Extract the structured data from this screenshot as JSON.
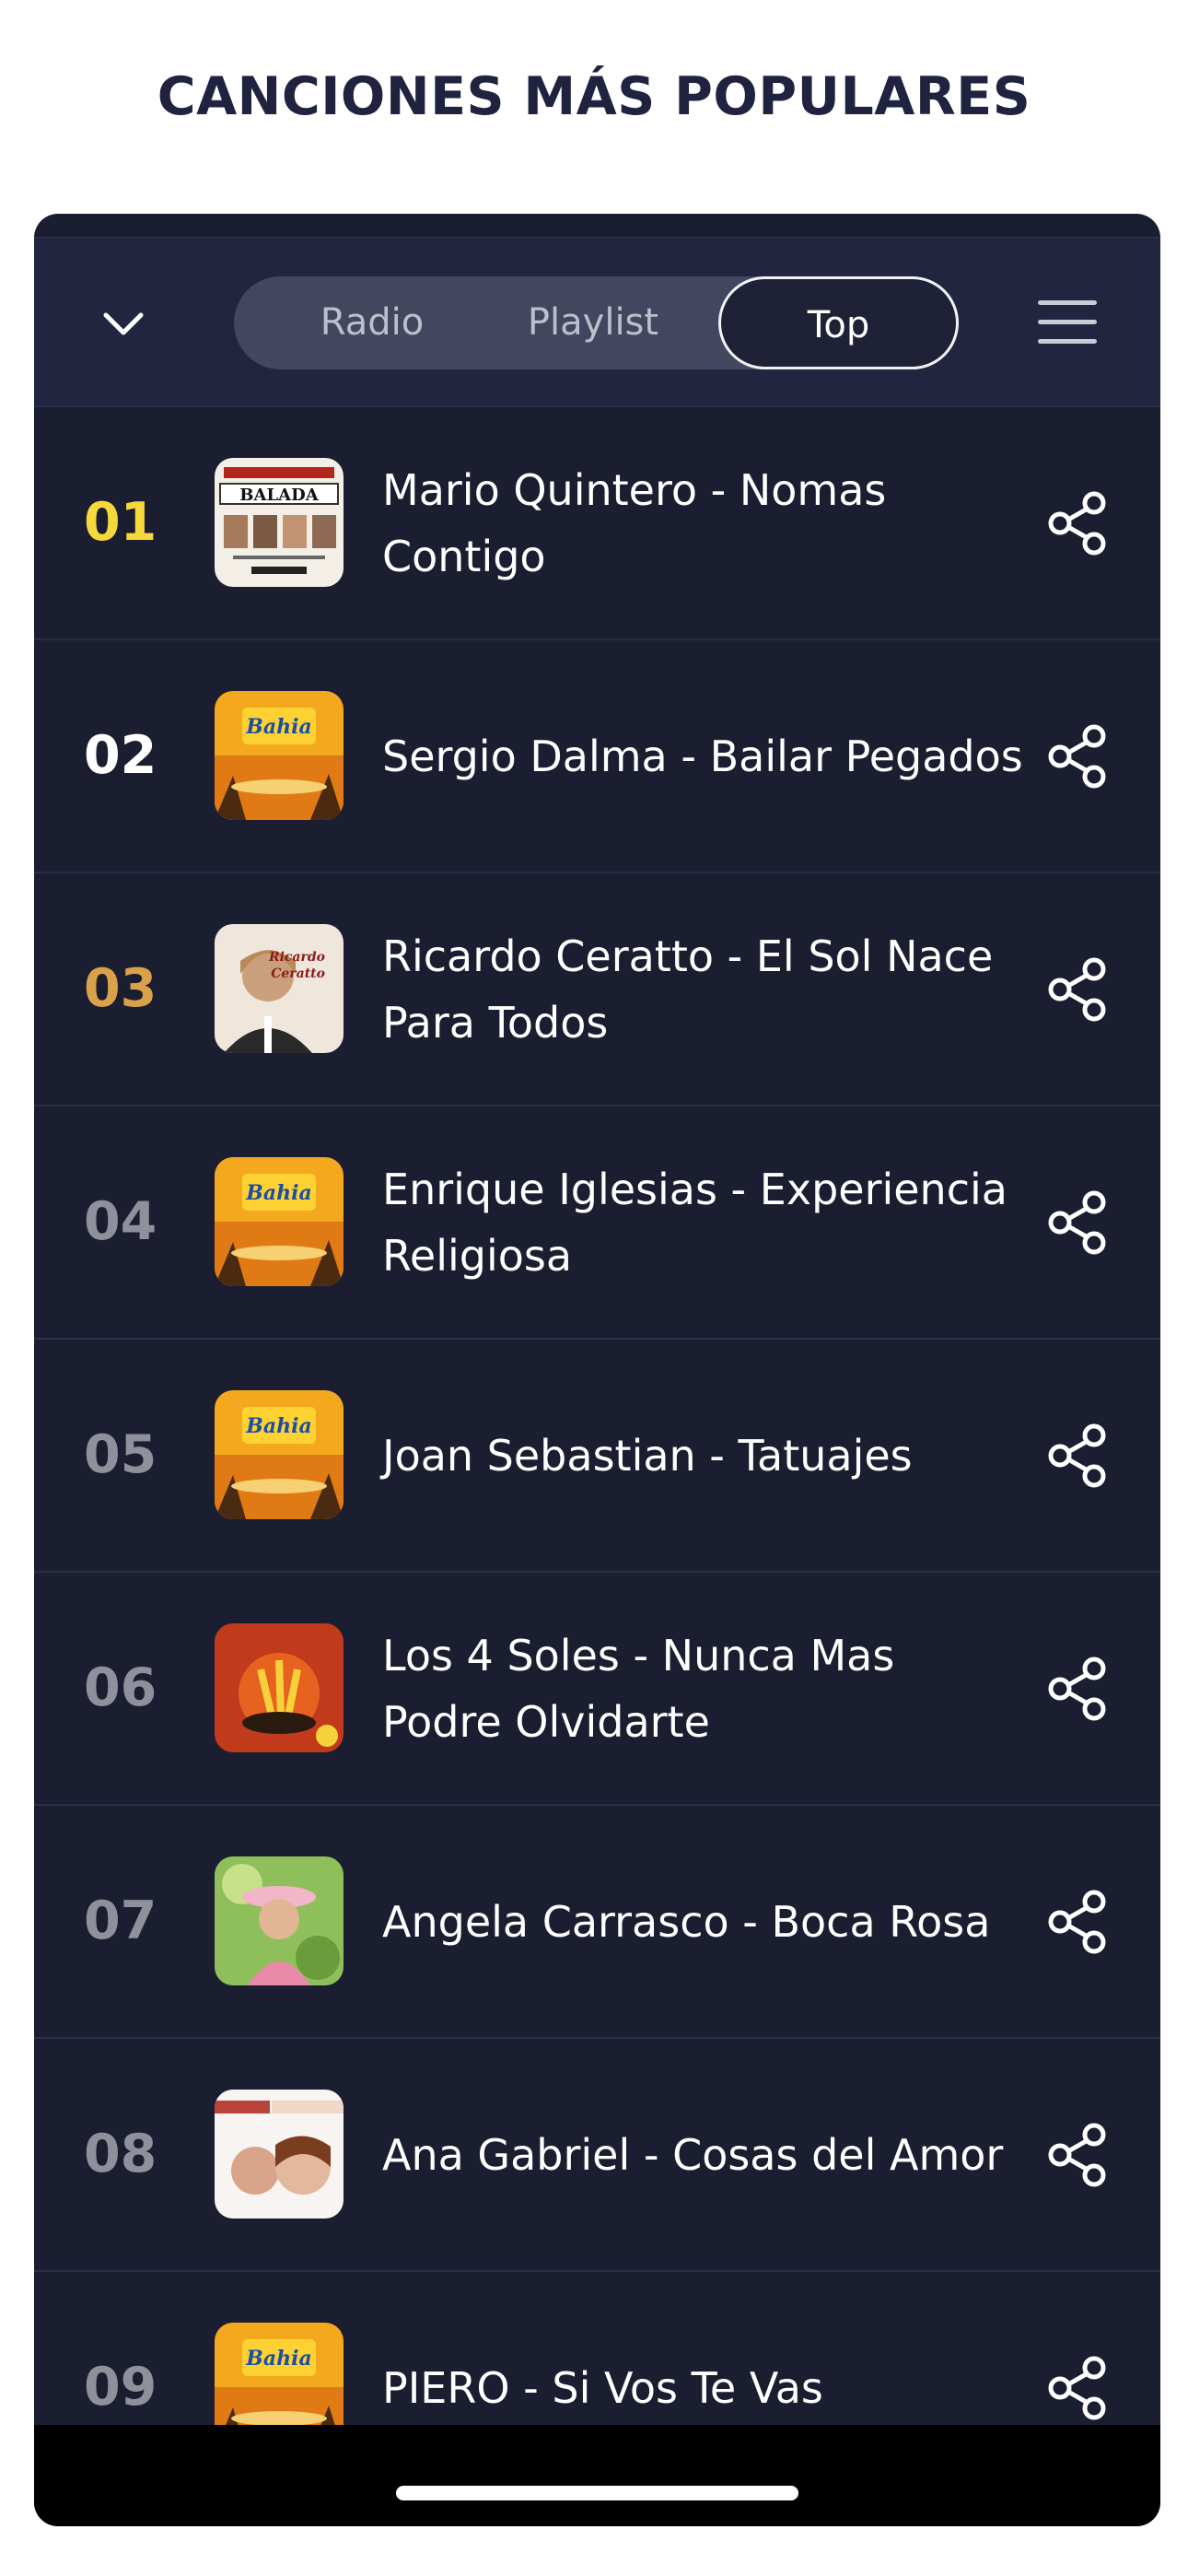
{
  "page": {
    "title": "CANCIONES MÁS POPULARES"
  },
  "header": {
    "tabs": [
      {
        "label": "Radio",
        "active": false
      },
      {
        "label": "Playlist",
        "active": false
      },
      {
        "label": "Top",
        "active": true
      }
    ]
  },
  "colors": {
    "rank_1": "#f5d93a",
    "rank_2": "#ffffff",
    "rank_3": "#d9a24a",
    "rank_default": "#8e909b",
    "panel_bg": "#1b1d30"
  },
  "tracks": [
    {
      "rank": "01",
      "title": "Mario Quintero - Nomas Contigo",
      "cover": "balada-cover"
    },
    {
      "rank": "02",
      "title": "Sergio Dalma - Bailar Pegados",
      "cover": "bahia-cover"
    },
    {
      "rank": "03",
      "title": "Ricardo Ceratto - El Sol Nace Para Todos",
      "cover": "ricardo-ceratto-cover"
    },
    {
      "rank": "04",
      "title": "Enrique Iglesias - Experiencia Religiosa",
      "cover": "bahia-cover"
    },
    {
      "rank": "05",
      "title": "Joan Sebastian - Tatuajes",
      "cover": "bahia-cover"
    },
    {
      "rank": "06",
      "title": "Los 4 Soles - Nunca Mas Podre Olvidarte",
      "cover": "gruperas-cover"
    },
    {
      "rank": "07",
      "title": "Angela Carrasco - Boca Rosa",
      "cover": "angela-carrasco-cover"
    },
    {
      "rank": "08",
      "title": "Ana Gabriel - Cosas del Amor",
      "cover": "ana-gabriel-cover"
    },
    {
      "rank": "09",
      "title": "PIERO - Si Vos Te Vas",
      "cover": "bahia-cover"
    }
  ]
}
